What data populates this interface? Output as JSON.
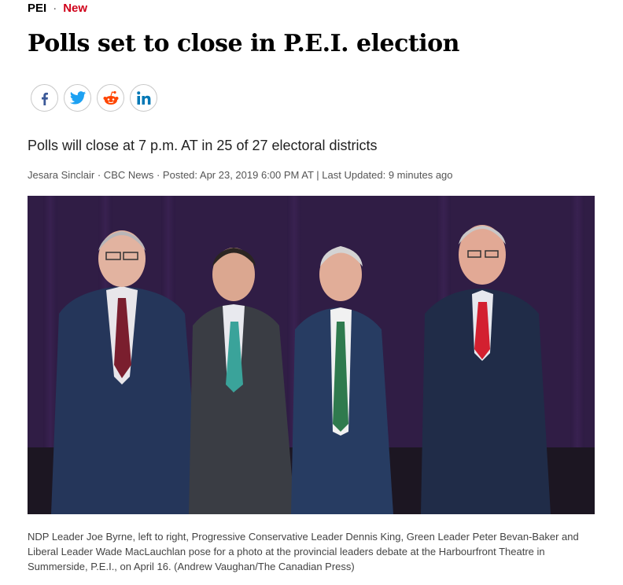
{
  "kicker": {
    "section": "PEI",
    "separator": "·",
    "badge": "New",
    "badge_color": "#d0021b"
  },
  "headline": "Polls set to close in P.E.I. election",
  "share": [
    {
      "name": "facebook-icon",
      "color": "#3b5998"
    },
    {
      "name": "twitter-icon",
      "color": "#1da1f2"
    },
    {
      "name": "reddit-icon",
      "color": "#ff4500"
    },
    {
      "name": "linkedin-icon",
      "color": "#0077b5"
    }
  ],
  "deck": "Polls will close at 7 p.m. AT in 25 of 27 electoral districts",
  "byline": "Jesara Sinclair · CBC News · Posted: Apr 23, 2019 6:00 PM AT | Last Updated: 9 minutes ago",
  "caption": "NDP Leader Joe Byrne, left to right, Progressive Conservative Leader Dennis King, Green Leader Peter Bevan-Baker and Liberal Leader Wade MacLauchlan pose for a photo at the provincial leaders debate at the Harbourfront Theatre in Summerside, P.E.I., on April 16. (Andrew Vaughan/The Canadian Press)"
}
